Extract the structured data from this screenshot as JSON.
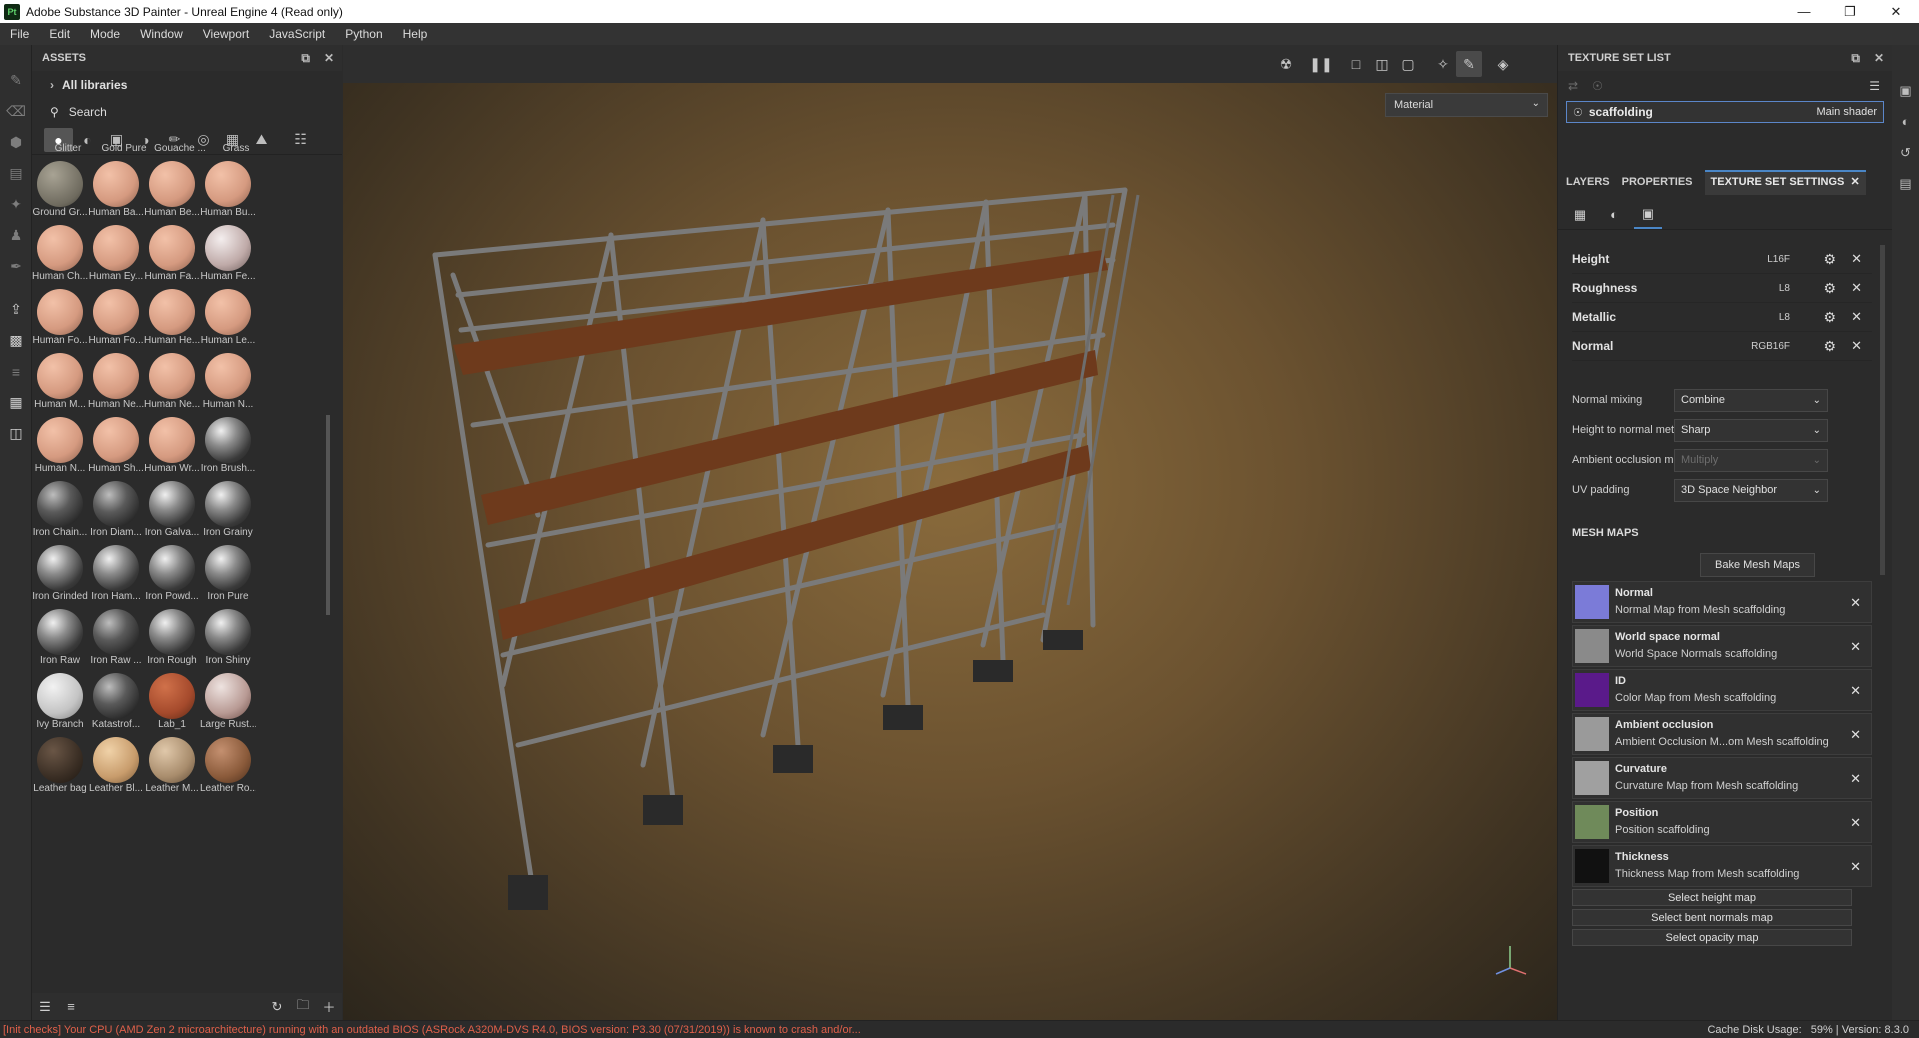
{
  "window": {
    "title": "Adobe Substance 3D Painter - Unreal Engine 4 (Read only)",
    "icon_text": "Pt"
  },
  "menu": [
    "File",
    "Edit",
    "Mode",
    "Window",
    "Viewport",
    "JavaScript",
    "Python",
    "Help"
  ],
  "assets": {
    "title": "ASSETS",
    "library": "All libraries",
    "search_placeholder": "Search",
    "top_row": [
      "Glitter",
      "Gold Pure",
      "Gouache ...",
      "Grass"
    ],
    "items": [
      {
        "name": "Ground Gr...",
        "color": "stone"
      },
      {
        "name": "Human Ba...",
        "color": "skin"
      },
      {
        "name": "Human Be...",
        "color": "skin"
      },
      {
        "name": "Human Bu...",
        "color": "skin"
      },
      {
        "name": "Human Ch...",
        "color": "skin"
      },
      {
        "name": "Human Ey...",
        "color": "skin"
      },
      {
        "name": "Human Fa...",
        "color": "skin"
      },
      {
        "name": "Human Fe...",
        "color": "skinwhite"
      },
      {
        "name": "Human Fo...",
        "color": "skin"
      },
      {
        "name": "Human Fo...",
        "color": "skin"
      },
      {
        "name": "Human He...",
        "color": "skin"
      },
      {
        "name": "Human Le...",
        "color": "skin"
      },
      {
        "name": "Human M...",
        "color": "skin"
      },
      {
        "name": "Human Ne...",
        "color": "skin"
      },
      {
        "name": "Human Ne...",
        "color": "skin"
      },
      {
        "name": "Human N...",
        "color": "skin"
      },
      {
        "name": "Human N...",
        "color": "skin"
      },
      {
        "name": "Human Sh...",
        "color": "skin"
      },
      {
        "name": "Human Wr...",
        "color": "skin"
      },
      {
        "name": "Iron Brush...",
        "color": "iron"
      },
      {
        "name": "Iron Chain...",
        "color": "irondark"
      },
      {
        "name": "Iron Diam...",
        "color": "irondark"
      },
      {
        "name": "Iron Galva...",
        "color": "iron"
      },
      {
        "name": "Iron Grainy",
        "color": "iron"
      },
      {
        "name": "Iron Grinded",
        "color": "iron"
      },
      {
        "name": "Iron Ham...",
        "color": "iron"
      },
      {
        "name": "Iron Powd...",
        "color": "iron"
      },
      {
        "name": "Iron Pure",
        "color": "iron"
      },
      {
        "name": "Iron Raw",
        "color": "iron"
      },
      {
        "name": "Iron Raw ...",
        "color": "irondark"
      },
      {
        "name": "Iron Rough",
        "color": "iron"
      },
      {
        "name": "Iron Shiny",
        "color": "iron"
      },
      {
        "name": "Ivy Branch",
        "color": "ivy"
      },
      {
        "name": "Katastrof...",
        "color": "irondark"
      },
      {
        "name": "Lab_1",
        "color": "brick"
      },
      {
        "name": "Large Rust...",
        "color": "rust"
      },
      {
        "name": "Leather bag",
        "color": "leatherdark"
      },
      {
        "name": "Leather Bl...",
        "color": "leatherlight"
      },
      {
        "name": "Leather M...",
        "color": "leathermid"
      },
      {
        "name": "Leather Ro...",
        "color": "leatherbrown"
      }
    ]
  },
  "viewport": {
    "mode_select": "Material"
  },
  "texture_set_list": {
    "title": "TEXTURE SET LIST",
    "item_name": "scaffolding",
    "item_shader": "Main shader"
  },
  "tabs": [
    "LAYERS",
    "PROPERTIES",
    "TEXTURE SET SETTINGS"
  ],
  "channels": [
    {
      "name": "Height",
      "format": "L16F"
    },
    {
      "name": "Roughness",
      "format": "L8"
    },
    {
      "name": "Metallic",
      "format": "L8"
    },
    {
      "name": "Normal",
      "format": "RGB16F"
    }
  ],
  "settings": [
    {
      "label": "Normal mixing",
      "value": "Combine",
      "disabled": false
    },
    {
      "label": "Height to normal method",
      "value": "Sharp",
      "disabled": false
    },
    {
      "label": "Ambient occlusion mixing",
      "value": "Multiply",
      "disabled": true
    },
    {
      "label": "UV padding",
      "value": "3D Space Neighbor",
      "disabled": false
    }
  ],
  "mesh_maps": {
    "title": "MESH MAPS",
    "bake_button": "Bake Mesh Maps",
    "items": [
      {
        "name": "Normal",
        "desc": "Normal Map from Mesh scaffolding",
        "thumb": "#7b7bd8"
      },
      {
        "name": "World space normal",
        "desc": "World Space Normals scaffolding",
        "thumb": "#8a8a8a"
      },
      {
        "name": "ID",
        "desc": "Color Map from Mesh scaffolding",
        "thumb": "#5a1a8a"
      },
      {
        "name": "Ambient occlusion",
        "desc": "Ambient Occlusion M...om Mesh scaffolding",
        "thumb": "#9a9a9a"
      },
      {
        "name": "Curvature",
        "desc": "Curvature Map from Mesh scaffolding",
        "thumb": "#a0a0a0"
      },
      {
        "name": "Position",
        "desc": "Position scaffolding",
        "thumb": "#6f8a5a"
      },
      {
        "name": "Thickness",
        "desc": "Thickness Map from Mesh scaffolding",
        "thumb": "#111111"
      }
    ],
    "select_buttons": [
      "Select height map",
      "Select bent normals map",
      "Select opacity map"
    ]
  },
  "status": {
    "message": "[Init checks] Your CPU (AMD Zen 2 microarchitecture) running with an outdated BIOS (ASRock A320M-DVS R4.0, BIOS version: P3.30 (07/31/2019)) is known to crash and/or...",
    "cache": "Cache Disk Usage:",
    "cache_value": "59%",
    "version": "Version: 8.3.0"
  },
  "colors": {
    "accent": "#4a86c6",
    "status_error": "#e0604a"
  }
}
